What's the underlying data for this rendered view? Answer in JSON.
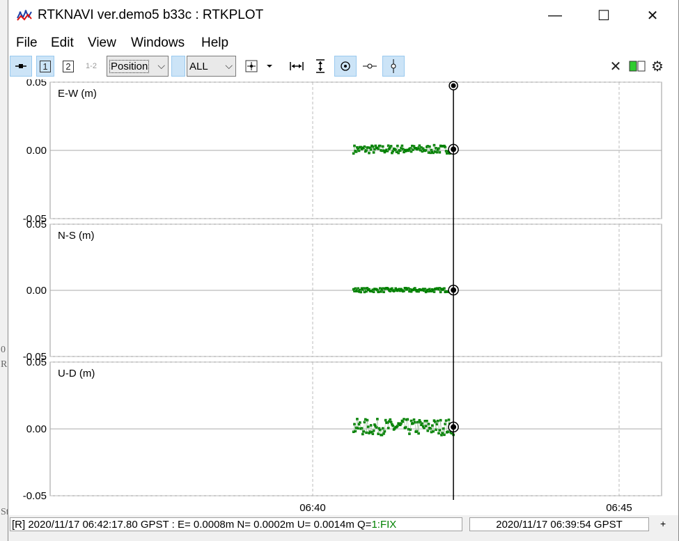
{
  "window": {
    "title": "RTKNAVI ver.demo5 b33c : RTKPLOT",
    "minimize": "—",
    "maximize": "☐",
    "close": "✕"
  },
  "menu": [
    "File",
    "Edit",
    "View",
    "Windows",
    "Help"
  ],
  "toolbar": {
    "plot_type": "Position",
    "filter": "ALL",
    "tab1": "1",
    "tab2": "2",
    "tab12": "1-2",
    "close_glyph": "✕",
    "settings_glyph": "⚙"
  },
  "panels": [
    {
      "label": "E-W (m)",
      "ticks": [
        "0.05",
        "0.00",
        "-0.05"
      ]
    },
    {
      "label": "N-S (m)",
      "ticks": [
        "0.05",
        "0.00",
        "-0.05"
      ]
    },
    {
      "label": "U-D (m)",
      "ticks": [
        "0.05",
        "0.00",
        "-0.05"
      ]
    }
  ],
  "chart_data": {
    "type": "scatter",
    "series": [
      {
        "name": "E-W (m)",
        "center": 0.0008,
        "spread": 0.003
      },
      {
        "name": "N-S (m)",
        "center": 0.0002,
        "spread": 0.0015
      },
      {
        "name": "U-D (m)",
        "center": 0.0014,
        "spread": 0.006
      }
    ],
    "x_ticks": [
      "06:40",
      "06:45"
    ],
    "ylim": [
      -0.05,
      0.05
    ],
    "time_start": "06:40:40",
    "time_end": "06:42:17.80",
    "point_color": "#008000",
    "grid": true
  },
  "status": {
    "left_prefix": "[R] 2020/11/17 06:42:17.80 GPST : E= 0.0008m N= 0.0002m U= 0.0014m Q=",
    "quality": "1:FIX",
    "right": "2020/11/17 06:39:54 GPST",
    "plus": "+"
  },
  "background": {
    "text_a": "0",
    "text_b": "R",
    "text_c": "St"
  }
}
